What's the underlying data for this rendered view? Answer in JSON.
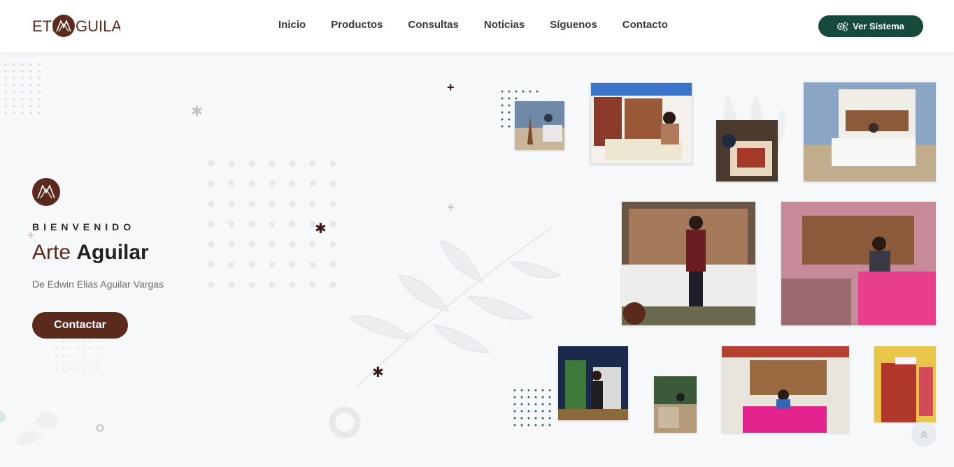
{
  "header": {
    "logo_text": "ETRA GUILAR",
    "nav": [
      "Inicio",
      "Productos",
      "Consultas",
      "Noticias",
      "Síguenos",
      "Contacto"
    ],
    "system_button": "Ver Sistema"
  },
  "hero": {
    "welcome": "BIENVENIDO",
    "title_light": "Arte",
    "title_bold": "Aguilar",
    "subtitle": "De Edwin Elias Aguilar Vargas",
    "contact_button": "Contactar"
  },
  "colors": {
    "brand": "#5a2a1c",
    "accent": "#164a3c",
    "background": "#f7f8f9"
  },
  "icons": {
    "system": "gears-icon",
    "scroll_top": "double-chevron-up-icon"
  }
}
